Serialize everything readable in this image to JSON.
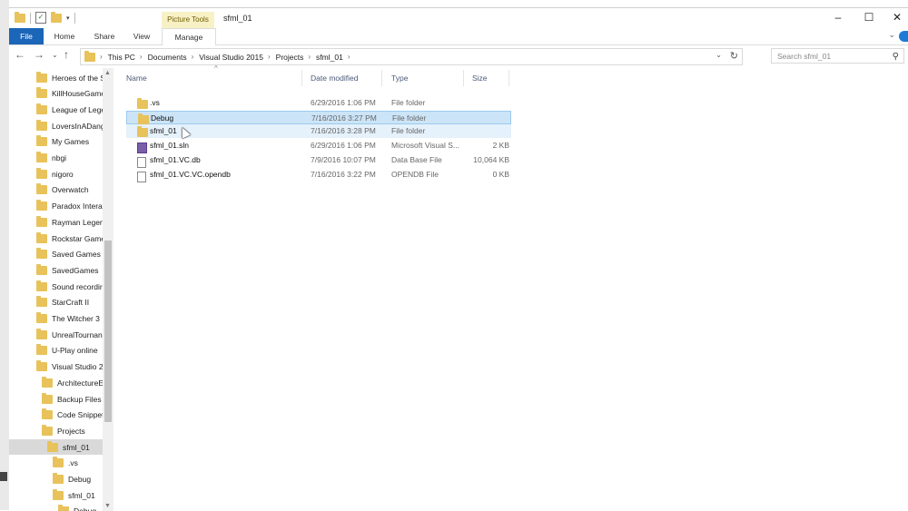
{
  "titlebar": {
    "context_tab": "Picture Tools",
    "title": "sfml_01",
    "minimize": "–",
    "maximize": "☐",
    "close": "✕"
  },
  "ribbon": {
    "tabs": [
      "File",
      "Home",
      "Share",
      "View",
      "Manage"
    ],
    "collapse": "⌄"
  },
  "address": {
    "crumbs": [
      "This PC",
      "Documents",
      "Visual Studio 2015",
      "Projects",
      "sfml_01"
    ],
    "search_placeholder": "Search sfml_01"
  },
  "nav_pane": {
    "items": [
      {
        "label": "Heroes of the S"
      },
      {
        "label": "KillHouseGame"
      },
      {
        "label": "League of Lege"
      },
      {
        "label": "LoversInADang"
      },
      {
        "label": "My Games"
      },
      {
        "label": "nbgi"
      },
      {
        "label": "nigoro"
      },
      {
        "label": "Overwatch"
      },
      {
        "label": "Paradox Interac"
      },
      {
        "label": "Rayman Legen"
      },
      {
        "label": "Rockstar Game"
      },
      {
        "label": "Saved Games"
      },
      {
        "label": "SavedGames"
      },
      {
        "label": "Sound recordir"
      },
      {
        "label": "StarCraft II"
      },
      {
        "label": "The Witcher 3"
      },
      {
        "label": "UnrealTournan"
      },
      {
        "label": "U-Play online"
      },
      {
        "label": "Visual Studio 2("
      },
      {
        "label": "ArchitectureE"
      },
      {
        "label": "Backup Files"
      },
      {
        "label": "Code Snippet"
      },
      {
        "label": "Projects"
      },
      {
        "label": "sfml_01"
      },
      {
        "label": ".vs"
      },
      {
        "label": "Debug"
      },
      {
        "label": "sfml_01"
      },
      {
        "label": "Debug"
      }
    ]
  },
  "columns": {
    "name": "Name",
    "date": "Date modified",
    "type": "Type",
    "size": "Size"
  },
  "files": [
    {
      "name": ".vs",
      "date": "6/29/2016 1:06 PM",
      "type": "File folder",
      "size": "",
      "icon": "folder-icon"
    },
    {
      "name": "Debug",
      "date": "7/16/2016 3:27 PM",
      "type": "File folder",
      "size": "",
      "icon": "folder-icon"
    },
    {
      "name": "sfml_01",
      "date": "7/16/2016 3:28 PM",
      "type": "File folder",
      "size": "",
      "icon": "folder-icon"
    },
    {
      "name": "sfml_01.sln",
      "date": "6/29/2016 1:06 PM",
      "type": "Microsoft Visual S...",
      "size": "2 KB",
      "icon": "solution-file-icon"
    },
    {
      "name": "sfml_01.VC.db",
      "date": "7/9/2016 10:07 PM",
      "type": "Data Base File",
      "size": "10,064 KB",
      "icon": "database-file-icon"
    },
    {
      "name": "sfml_01.VC.VC.opendb",
      "date": "7/16/2016 3:22 PM",
      "type": "OPENDB File",
      "size": "0 KB",
      "icon": "file-icon"
    }
  ],
  "colors": {
    "file_tab": "#1b66b8",
    "folder": "#e8c25a",
    "selection": "#cce4f7",
    "hover": "#e5f1fb"
  }
}
